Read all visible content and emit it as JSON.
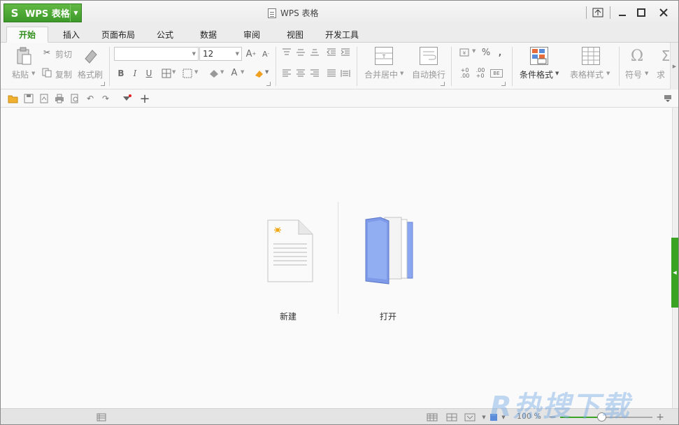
{
  "app": {
    "name": "WPS 表格",
    "logo": "S"
  },
  "window": {
    "title": "WPS 表格"
  },
  "tabs": [
    {
      "label": "开始",
      "active": true
    },
    {
      "label": "插入"
    },
    {
      "label": "页面布局"
    },
    {
      "label": "公式"
    },
    {
      "label": "数据"
    },
    {
      "label": "审阅"
    },
    {
      "label": "视图"
    },
    {
      "label": "开发工具"
    }
  ],
  "ribbon": {
    "paste": "粘贴",
    "cut": "剪切",
    "copy": "复制",
    "format_painter": "格式刷",
    "font_name": "",
    "font_size": "12",
    "merge_center": "合并居中",
    "wrap_text": "自动换行",
    "conditional_format": "条件格式",
    "table_style": "表格样式",
    "symbol": "符号",
    "sum": "求"
  },
  "main": {
    "new_label": "新建",
    "open_label": "打开"
  },
  "status": {
    "zoom": "100 %",
    "zoom_level": 0.45
  },
  "watermark": "R热搜下载",
  "colors": {
    "accent": "#3ba324",
    "folder": "#8aa6f0"
  }
}
